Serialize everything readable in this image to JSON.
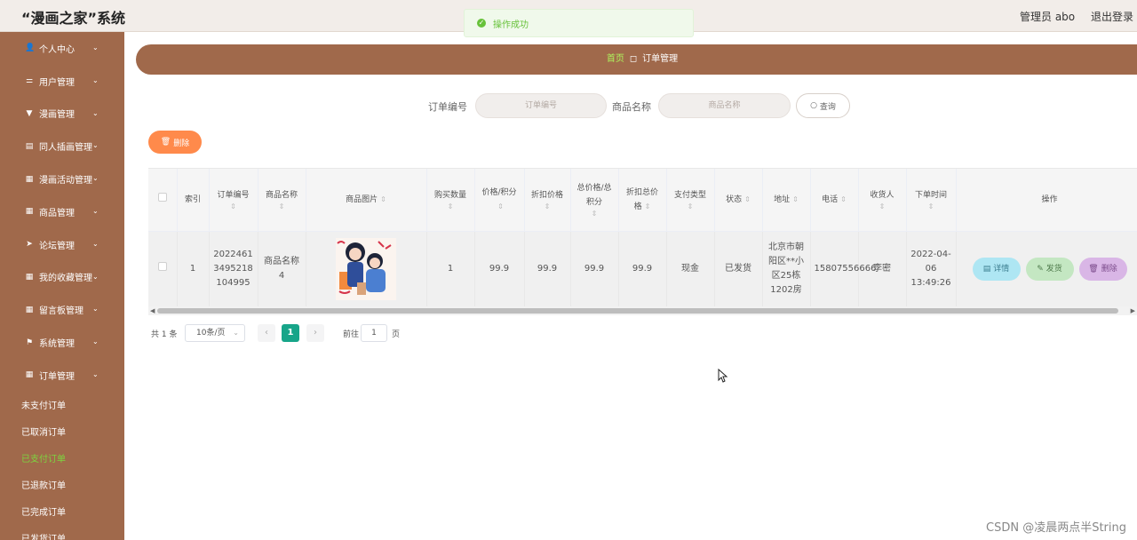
{
  "header": {
    "brand": "“漫画之家”系统",
    "user": "管理员 abo",
    "logout": "退出登录"
  },
  "toast": {
    "message": "操作成功"
  },
  "sidebar": {
    "items": [
      {
        "label": "个人中心",
        "icon": "user-icon",
        "glyph": "👤"
      },
      {
        "label": "用户管理",
        "icon": "sliders-icon",
        "glyph": "⚌"
      },
      {
        "label": "漫画管理",
        "icon": "filter-icon",
        "glyph": "▼"
      },
      {
        "label": "同人插画管理",
        "icon": "box-icon",
        "glyph": "▤"
      },
      {
        "label": "漫画活动管理",
        "icon": "grid-icon",
        "glyph": "▦"
      },
      {
        "label": "商品管理",
        "icon": "grid-icon",
        "glyph": "▦"
      },
      {
        "label": "论坛管理",
        "icon": "send-icon",
        "glyph": "➤"
      },
      {
        "label": "我的收藏管理",
        "icon": "grid-icon",
        "glyph": "▦"
      },
      {
        "label": "留言板管理",
        "icon": "grid-icon",
        "glyph": "▦"
      },
      {
        "label": "系统管理",
        "icon": "flag-icon",
        "glyph": "⚑"
      },
      {
        "label": "订单管理",
        "icon": "grid-icon",
        "glyph": "▦"
      }
    ],
    "sub_items": [
      {
        "label": "未支付订单",
        "active": false
      },
      {
        "label": "已取消订单",
        "active": false
      },
      {
        "label": "已支付订单",
        "active": true
      },
      {
        "label": "已退款订单",
        "active": false
      },
      {
        "label": "已完成订单",
        "active": false
      },
      {
        "label": "已发货订单",
        "active": false
      }
    ]
  },
  "breadcrumb": {
    "home": "首页",
    "current": "订单管理"
  },
  "search": {
    "order_no_label": "订单编号",
    "order_no_placeholder": "订单编号",
    "product_label": "商品名称",
    "product_placeholder": "商品名称",
    "query_button": "查询"
  },
  "toolbar": {
    "delete_button": "删除"
  },
  "table": {
    "headers": {
      "index": "索引",
      "order_no": "订单编号",
      "product_name": "商品名称",
      "product_image": "商品图片",
      "quantity": "购买数量",
      "price": "价格/积分",
      "discount_price": "折扣价格",
      "total": "总价格/总积分",
      "discount_total": "折扣总价格",
      "pay_type": "支付类型",
      "status": "状态",
      "address": "地址",
      "phone": "电话",
      "receiver": "收货人",
      "order_time": "下单时间",
      "actions": "操作"
    },
    "rows": [
      {
        "index": "1",
        "order_no": "2022461 3495218 104995",
        "product_name": "商品名称4",
        "quantity": "1",
        "price": "99.9",
        "discount_price": "99.9",
        "total": "99.9",
        "discount_total": "99.9",
        "pay_type": "现金",
        "status": "已发货",
        "address": "北京市朝阳区**小区25栋1202房",
        "phone": "15807556666",
        "receiver": "李密",
        "order_time": "2022-04-06 13:49:26",
        "btn_detail": "详情",
        "btn_ship": "发货",
        "btn_delete": "删除"
      }
    ]
  },
  "pagination": {
    "total": "共 1 条",
    "page_size": "10条/页",
    "current_page": "1",
    "goto_label": "前往",
    "goto_value": "1",
    "page_word": "页"
  },
  "watermark": "CSDN @凌晨两点半String"
}
